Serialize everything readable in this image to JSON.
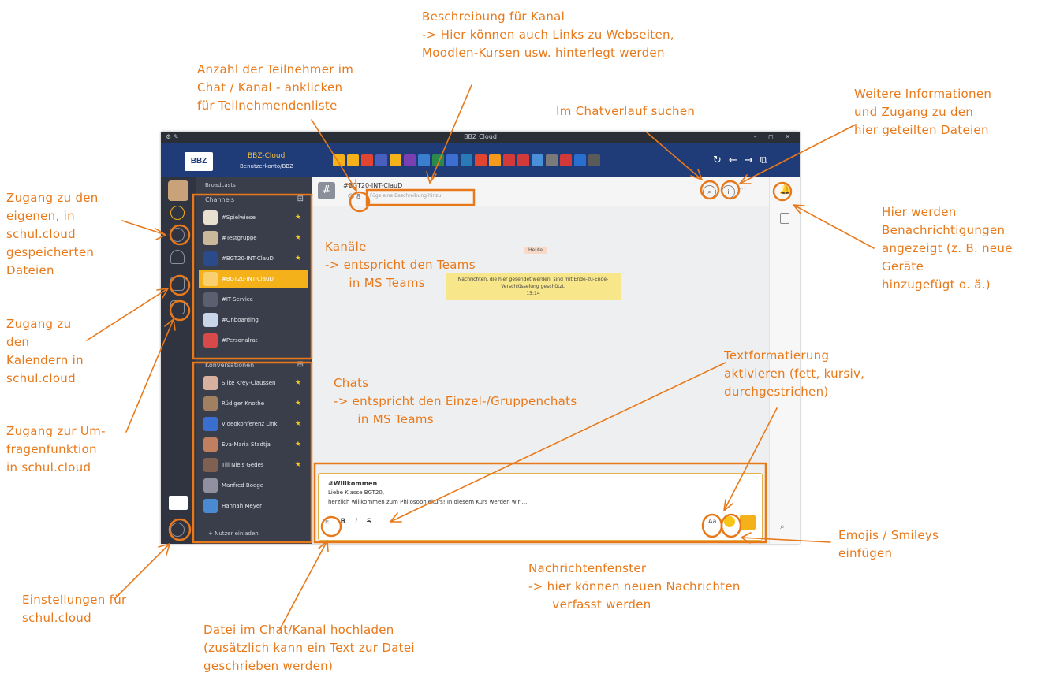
{
  "annotations": {
    "beschreibung": "Beschreibung für Kanal\n-> Hier können auch Links zu Webseiten,\nMoodlen-Kursen usw. hinterlegt werden",
    "teilnehmer": "Anzahl der Teilnehmer im\nChat / Kanal - anklicken\nfür Teilnehmendenliste",
    "suchen": "Im Chatverlauf suchen",
    "weitere": "Weitere Informationen\nund Zugang zu den\nhier geteilten Dateien",
    "dateien": "Zugang zu den\neigenen, in\nschul.cloud\ngespeicherten\nDateien",
    "kalender": "Zugang zu\nden\nKalendern in\nschul.cloud",
    "umfrage": "Zugang zur Um-\nfragenfunktion\nin schul.cloud",
    "benachrichtigungen": "Hier werden\nBenachrichtigungen\nangezeigt (z. B. neue\nGeräte\nhinzugefügt o. ä.)",
    "kanaele": "Kanäle\n-> entspricht den Teams\n      in MS Teams",
    "chats": "Chats\n-> entspricht den Einzel-/Gruppenchats\n      in MS Teams",
    "textformat": "Textformatierung\naktivieren (fett, kursiv,\ndurchgestrichen)",
    "emojis": "Emojis / Smileys\neinfügen",
    "nachrichtenfenster": "Nachrichtenfenster\n-> hier können neuen Nachrichten\n      verfasst werden",
    "einstellungen": "Einstellungen für\nschul.cloud",
    "hochladen": "Datei im Chat/Kanal hochladen\n(zusätzlich kann ein Text zur Datei\ngeschrieben werden)"
  },
  "window": {
    "title": "BBZ Cloud",
    "brand": "BBZ",
    "app_name": "BBZ-Cloud",
    "app_sub": "Benutzerkonto/BBZ"
  },
  "app_colors": [
    "#f5b11a",
    "#f5b11a",
    "#e2452f",
    "#4a5fbd",
    "#f5b11a",
    "#7a3fb0",
    "#3a7fd0",
    "#2a8a4a",
    "#3c6fd0",
    "#2a7ab8",
    "#e2452f",
    "#f59a1a",
    "#d23a3a",
    "#d23a3a",
    "#4a90d9",
    "#7a7a7a",
    "#d23a3a",
    "#2a6fd0",
    "#5a5a5a"
  ],
  "sidebar": {
    "channels_header": "Channels",
    "channels": [
      {
        "label": "#Spielwiese",
        "starred": true,
        "color": "#e8e0d0"
      },
      {
        "label": "#Testgruppe",
        "starred": true,
        "color": "#c9b89a"
      },
      {
        "label": "#BGT20-INT-ClauD",
        "starred": true,
        "color": "#2a4a8a"
      },
      {
        "label": "#BGT20-INT-ClauD",
        "starred": false,
        "active": true,
        "color": "#f8d070"
      },
      {
        "label": "#IT-Service",
        "starred": false,
        "color": "#5a6070"
      },
      {
        "label": "#Onboarding",
        "starred": false,
        "color": "#c8d4e8"
      },
      {
        "label": "#Personalrat",
        "starred": false,
        "color": "#d84a4a"
      }
    ],
    "conversations_header": "Konversationen",
    "conversations": [
      {
        "label": "Silke Krey-Claussen",
        "starred": true,
        "color": "#d8b0a0"
      },
      {
        "label": "Rüdiger Knothe",
        "starred": true,
        "color": "#a08060"
      },
      {
        "label": "Videokonferenz Link",
        "starred": true,
        "color": "#3a6fd0"
      },
      {
        "label": "Eva-Maria Stadtja",
        "starred": true,
        "color": "#c08060"
      },
      {
        "label": "Till Niels Gedes",
        "starred": true,
        "color": "#806050"
      },
      {
        "label": "Manfred Boege",
        "starred": false,
        "color": "#9090a0"
      },
      {
        "label": "Hannah Meyer",
        "starred": false,
        "color": "#4a8ad0"
      }
    ],
    "invite": "+  Nutzer einladen"
  },
  "chat": {
    "channel_name": "#BGT20-INT-ClauD",
    "members": "8",
    "description_placeholder": "Füge eine Beschreibung hinzu",
    "day_label": "Heute",
    "e2e_line1": "Nachrichten, die hier gesendet werden, sind mit Ende-zu-Ende-",
    "e2e_line2": "Verschlüsselung geschützt.",
    "e2e_time": "15:14",
    "draft_title": "#Willkommen",
    "draft_line1": "Liebe Klasse BGT20,",
    "draft_line2": "herzlich willkommen zum Philosophiekurs! In diesem Kurs werden wir ...",
    "format_label": "Aa"
  }
}
